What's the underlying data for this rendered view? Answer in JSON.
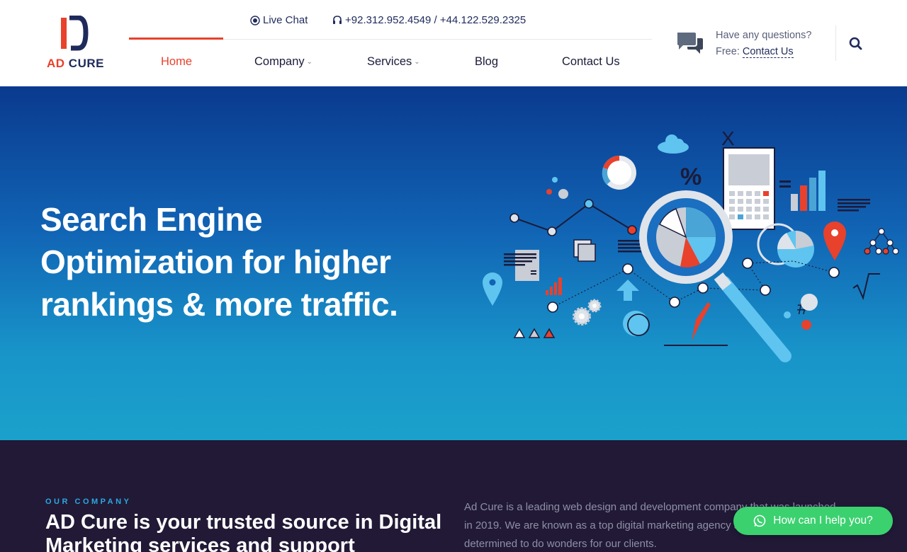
{
  "brand": {
    "name_part1": "AD",
    "name_part2": "CURE",
    "accent_color": "#e8412c",
    "primary_color": "#1f2a5c"
  },
  "topbar": {
    "live_chat_label": "Live Chat",
    "live_chat_icon": "target-icon",
    "phone_icon": "headset-icon",
    "phone_text": "+92.312.952.4549 / +44.122.529.2325"
  },
  "nav": {
    "items": [
      {
        "label": "Home",
        "active": true
      },
      {
        "label": "Company",
        "has_dropdown": true
      },
      {
        "label": "Services",
        "has_dropdown": true
      },
      {
        "label": "Blog"
      },
      {
        "label": "Contact Us"
      }
    ]
  },
  "questions": {
    "line1": "Have any questions?",
    "line2_prefix": "Free:",
    "line2_link": "Contact Us"
  },
  "hero": {
    "title": "Search Engine Optimization for higher rankings & more traffic."
  },
  "company": {
    "eyebrow": "OUR COMPANY",
    "heading": "AD Cure is your trusted source in Digital Marketing services and support",
    "description": "Ad Cure is a leading web design and development company that was launched in 2019. We are known as a top digital marketing agency and are always determined to do wonders for our clients."
  },
  "chat_widget": {
    "label": "How can I help you?",
    "icon": "whatsapp-icon",
    "color": "#3bd16f"
  }
}
